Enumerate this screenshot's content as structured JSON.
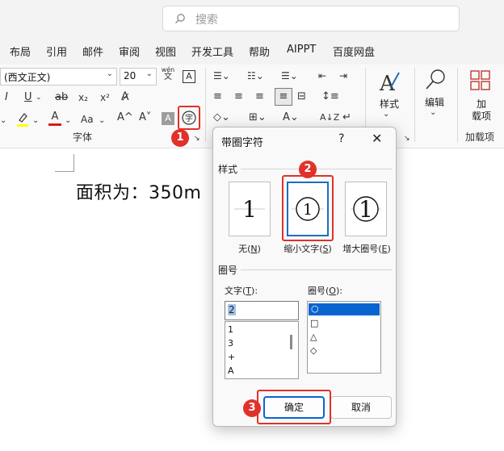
{
  "search": {
    "placeholder": "搜索"
  },
  "tabs": [
    "布局",
    "引用",
    "邮件",
    "审阅",
    "视图",
    "开发工具",
    "帮助",
    "AIPPT",
    "百度网盘"
  ],
  "ribbon": {
    "font_name": "(西文正文)",
    "font_size": "20",
    "phonetic_top": "wén",
    "phonetic_bottom": "文",
    "font_group_label": "字体",
    "styles_label": "样式",
    "edit_label": "编辑",
    "addin_label_1": "加",
    "addin_label_2": "载项",
    "addin_group_label": "加载项",
    "italic": "I",
    "underline": "U",
    "strike": "ab",
    "subscript": "x₂",
    "superscript": "x²",
    "grow": "A^",
    "shrink": "A˅",
    "case": "Aa",
    "font_color": "A"
  },
  "document": {
    "text": "面积为：350m"
  },
  "dialog": {
    "title": "带圈字符",
    "help": "?",
    "close": "✕",
    "style_section": "样式",
    "styles": [
      {
        "label": "无(",
        "key": "N",
        "tail": ")",
        "sample": "1"
      },
      {
        "label": "缩小文字(",
        "key": "S",
        "tail": ")",
        "sample": "①"
      },
      {
        "label": "增大圈号(",
        "key": "E",
        "tail": ")",
        "sample": "1"
      }
    ],
    "circle_section": "圈号",
    "text_label": "文字(",
    "text_key": "T",
    "text_tail": "):",
    "enclose_label": "圈号(",
    "enclose_key": "O",
    "enclose_tail": "):",
    "text_value": "2",
    "text_list": [
      "1",
      "3",
      "+",
      "A"
    ],
    "enclose_list": [
      "○",
      "□",
      "△",
      "◇"
    ],
    "ok": "确定",
    "cancel": "取消"
  },
  "callouts": [
    "1",
    "2",
    "3"
  ],
  "colors": {
    "accent": "#0a64d0",
    "callout": "#e0322a",
    "highlight": "#ffff00",
    "font_red": "#d01f1f"
  }
}
